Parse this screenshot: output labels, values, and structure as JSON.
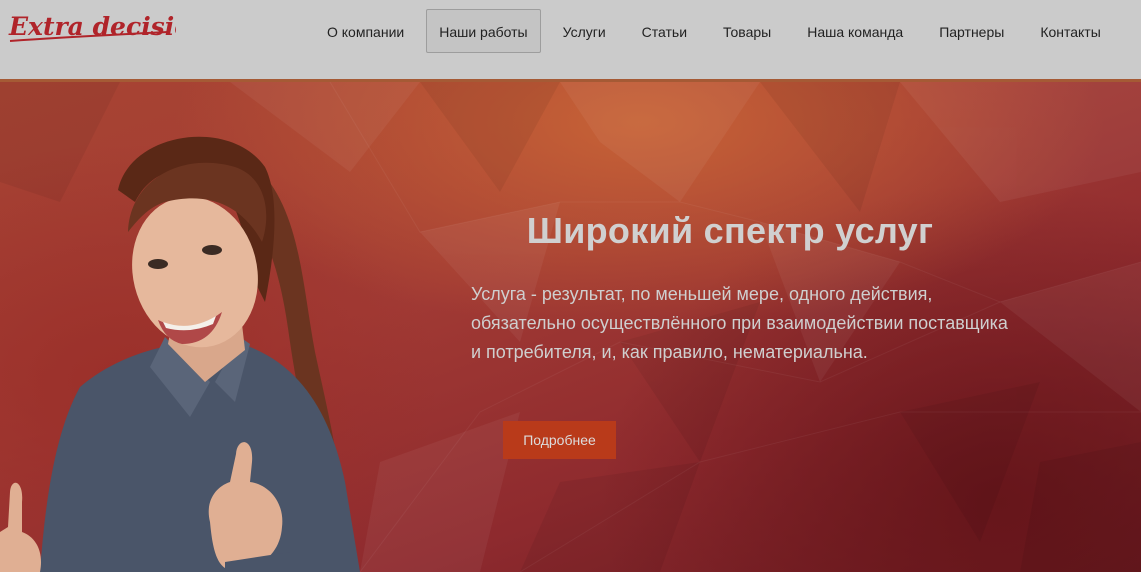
{
  "brand": {
    "logo_text": "Extra decision"
  },
  "nav": {
    "items": [
      {
        "label": "О компании"
      },
      {
        "label": "Наши работы"
      },
      {
        "label": "Услуги"
      },
      {
        "label": "Статьи"
      },
      {
        "label": "Товары"
      },
      {
        "label": "Наша команда"
      },
      {
        "label": "Партнеры"
      },
      {
        "label": "Контакты"
      }
    ]
  },
  "hero": {
    "title": "Широкий спектр услуг",
    "text": "Услуга - результат, по меньшей мере, одного действия, обязательно осуществлённого при взаимодействии поставщика и потребителя, и, как правило, нематериальна.",
    "button_label": "Подробнее"
  },
  "colors": {
    "accent": "#b93a1a",
    "header_bg": "#cbcbcb",
    "logo": "#b0242a"
  }
}
